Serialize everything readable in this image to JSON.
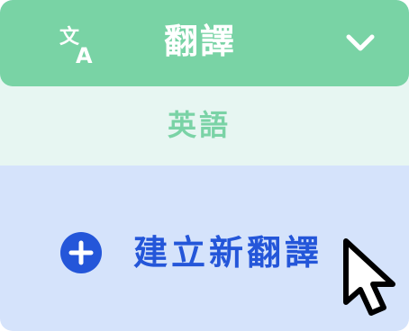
{
  "dropdown": {
    "title": "翻譯",
    "translate_icon": "translate-icon",
    "chevron_icon": "chevron-down-icon",
    "header_color": "#79d3a5"
  },
  "current_language": {
    "label": "英語",
    "background": "#e7f6f2",
    "text_color": "#7ad3a6"
  },
  "create_action": {
    "label": "建立新翻譯",
    "icon": "add-circle-icon",
    "background": "#d5e3fb",
    "accent": "#2456d9"
  },
  "pointer": {
    "icon": "mouse-pointer-icon"
  }
}
